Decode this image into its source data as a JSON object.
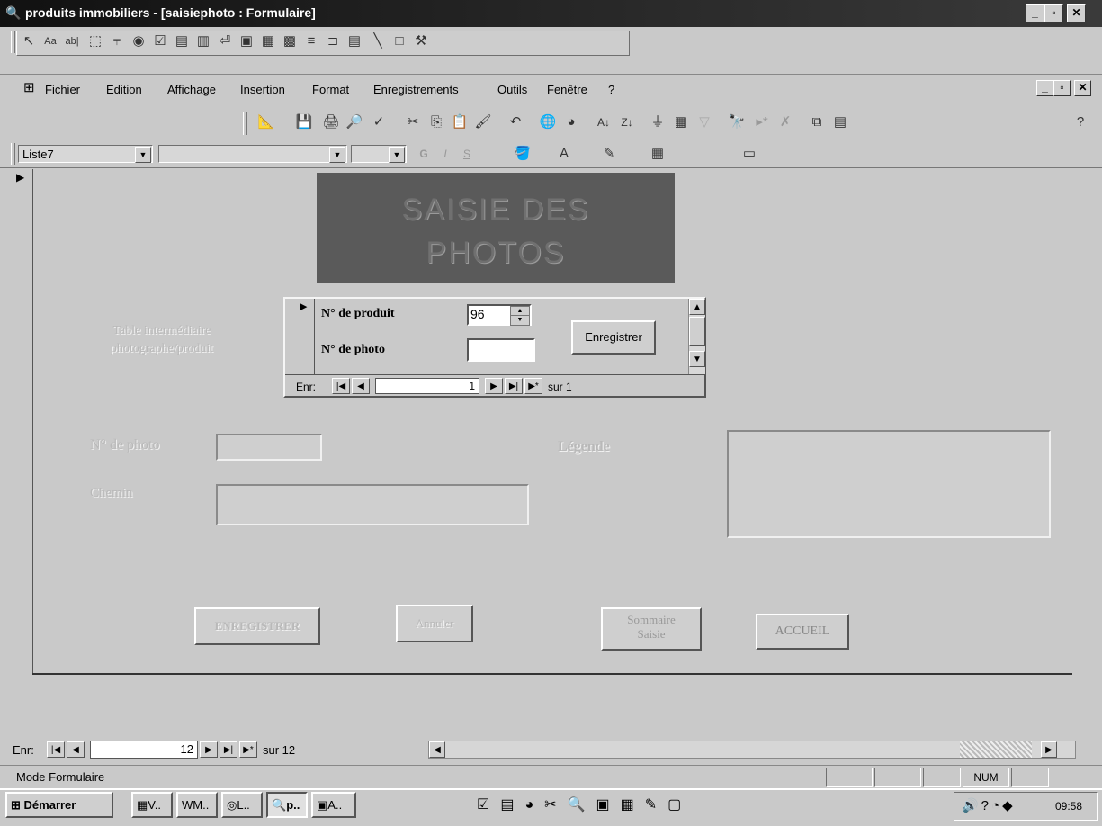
{
  "window": {
    "title": "produits immobiliers - [saisiephoto : Formulaire]"
  },
  "menu": [
    "Fichier",
    "Edition",
    "Affichage",
    "Insertion",
    "Format",
    "Enregistrements",
    "Outils",
    "Fenêtre",
    "?"
  ],
  "format_bar": {
    "object_selector": "Liste7"
  },
  "form": {
    "header_line1": "SAISIE DES",
    "header_line2": "PHOTOS",
    "subform_label_line1": "Table intermédiaire",
    "subform_label_line2": "photographe/produit",
    "subform": {
      "produit_label": "N° de produit",
      "produit_value": "96",
      "photo_label": "N° de photo",
      "photo_value": "",
      "save_button": "Enregistrer",
      "nav_label": "Enr:",
      "nav_current": "1",
      "nav_total": "sur 1"
    },
    "photo_label": "N° de photo",
    "legende_label": "Légende",
    "chemin_label": "Chemin",
    "buttons": {
      "enregistrer": "ENREGISTRER",
      "annuler": "Annuler",
      "sommaire_line1": "Sommaire",
      "sommaire_line2": "Saisie",
      "accueil": "ACCUEIL"
    }
  },
  "record_nav": {
    "label": "Enr:",
    "current": "12",
    "total": "sur 12"
  },
  "status": {
    "mode": "Mode Formulaire",
    "num": "NUM"
  },
  "taskbar": {
    "start": "Démarrer",
    "tasks": [
      "V..",
      "M..",
      "L..",
      "p..",
      "A.."
    ],
    "clock": "09:58"
  }
}
